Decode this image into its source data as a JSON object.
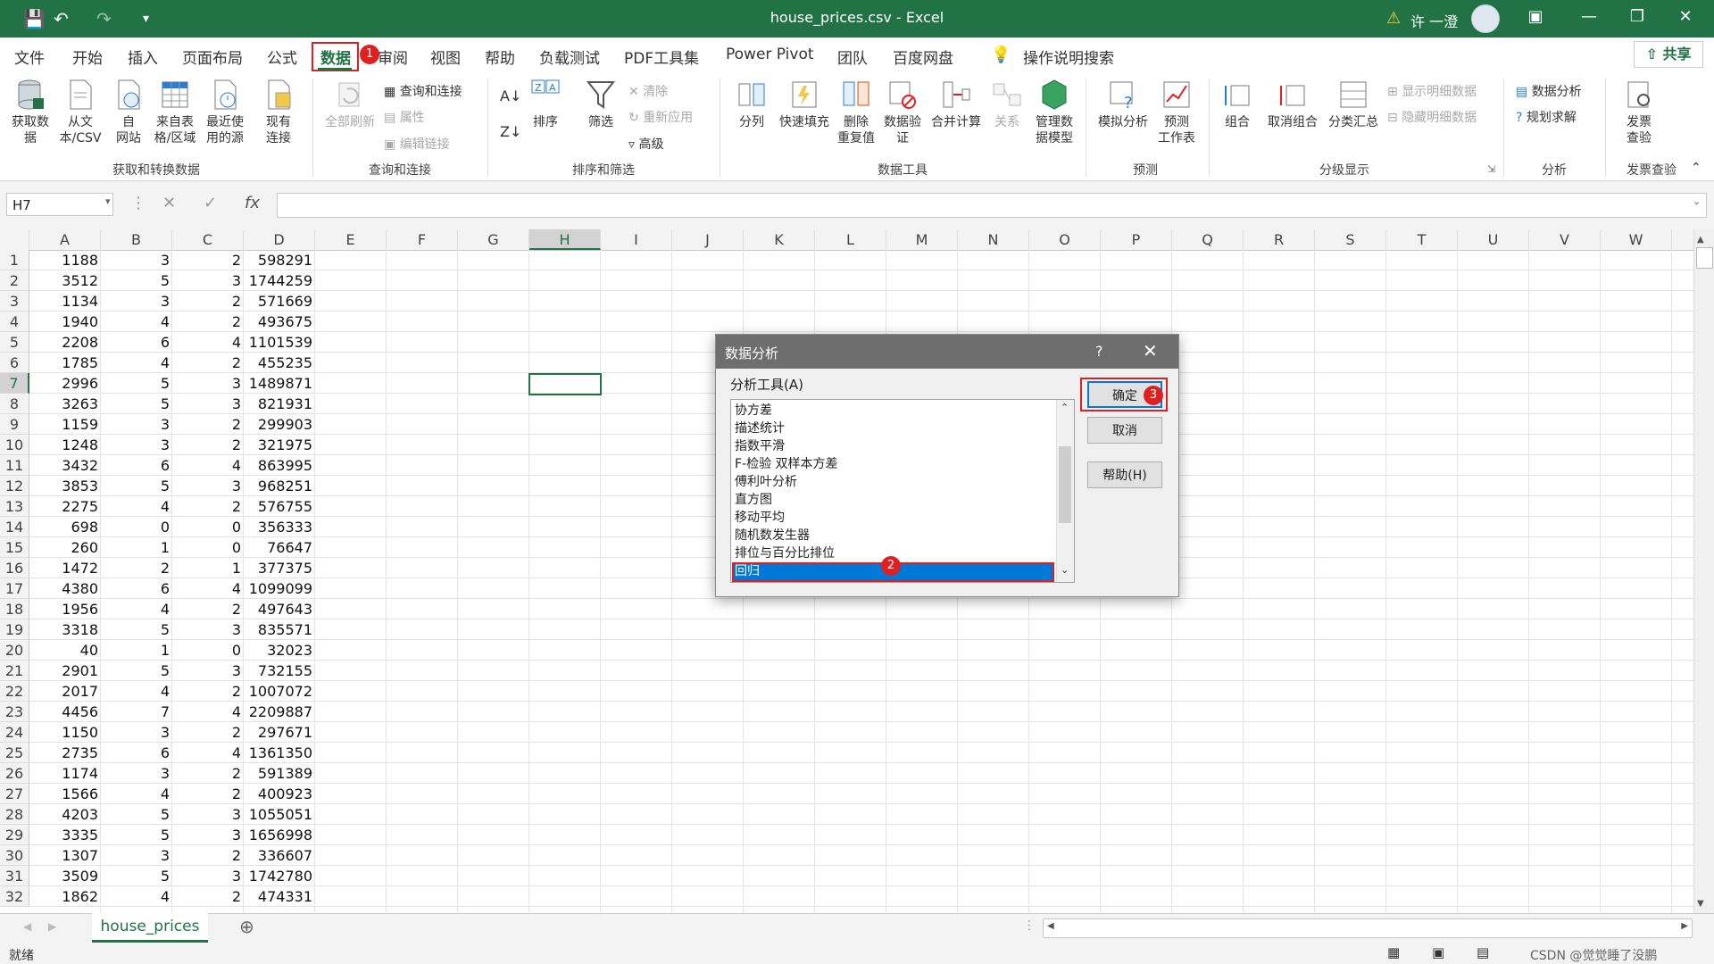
{
  "title": "house_prices.csv  -  Excel",
  "user": "许 一澄",
  "tabs": [
    "文件",
    "开始",
    "插入",
    "页面布局",
    "公式",
    "数据",
    "审阅",
    "视图",
    "帮助",
    "负载测试",
    "PDF工具集",
    "Power Pivot",
    "团队",
    "百度网盘"
  ],
  "tell_me": "操作说明搜索",
  "share": "共享",
  "ribbon": {
    "get_data": "获取数\n据",
    "from_csv": "从文\n本/CSV",
    "from_web": "自\n网站",
    "from_table": "来自表\n格/区域",
    "recent": "最近使\n用的源",
    "existing": "现有\n连接",
    "refresh_all": "全部刷新",
    "queries": "查询和连接",
    "properties": "属性",
    "edit_links": "编辑链接",
    "sort": "排序",
    "filter": "筛选",
    "clear": "清除",
    "reapply": "重新应用",
    "advanced": "高级",
    "text_to_col": "分列",
    "flash_fill": "快速填充",
    "remove_dup": "删除\n重复值",
    "validation": "数据验\n证",
    "consolidate": "合并计算",
    "relations": "关系",
    "data_model": "管理数\n据模型",
    "what_if": "模拟分析",
    "forecast": "预测\n工作表",
    "group": "组合",
    "ungroup": "取消组合",
    "subtotal": "分类汇总",
    "show_detail": "显示明细数据",
    "hide_detail": "隐藏明细数据",
    "data_analysis": "数据分析",
    "solver": "规划求解",
    "invoice": "发票\n查验",
    "groups": [
      "获取和转换数据",
      "查询和连接",
      "排序和筛选",
      "数据工具",
      "预测",
      "分级显示",
      "分析",
      "发票查验"
    ]
  },
  "name_box": "H7",
  "columns": [
    "A",
    "B",
    "C",
    "D",
    "E",
    "F",
    "G",
    "H",
    "I",
    "J",
    "K",
    "L",
    "M",
    "N",
    "O",
    "P",
    "Q",
    "R",
    "S",
    "T",
    "U",
    "V",
    "W"
  ],
  "rows": [
    [
      1188,
      3,
      2,
      598291
    ],
    [
      3512,
      5,
      3,
      1744259
    ],
    [
      1134,
      3,
      2,
      571669
    ],
    [
      1940,
      4,
      2,
      493675
    ],
    [
      2208,
      6,
      4,
      1101539
    ],
    [
      1785,
      4,
      2,
      455235
    ],
    [
      2996,
      5,
      3,
      1489871
    ],
    [
      3263,
      5,
      3,
      821931
    ],
    [
      1159,
      3,
      2,
      299903
    ],
    [
      1248,
      3,
      2,
      321975
    ],
    [
      3432,
      6,
      4,
      863995
    ],
    [
      3853,
      5,
      3,
      968251
    ],
    [
      2275,
      4,
      2,
      576755
    ],
    [
      698,
      0,
      0,
      356333
    ],
    [
      260,
      1,
      0,
      76647
    ],
    [
      1472,
      2,
      1,
      377375
    ],
    [
      4380,
      6,
      4,
      1099099
    ],
    [
      1956,
      4,
      2,
      497643
    ],
    [
      3318,
      5,
      3,
      835571
    ],
    [
      40,
      1,
      0,
      32023
    ],
    [
      2901,
      5,
      3,
      732155
    ],
    [
      2017,
      4,
      2,
      1007072
    ],
    [
      4456,
      7,
      4,
      2209887
    ],
    [
      1150,
      3,
      2,
      297671
    ],
    [
      2735,
      6,
      4,
      1361350
    ],
    [
      1174,
      3,
      2,
      591389
    ],
    [
      1566,
      4,
      2,
      400923
    ],
    [
      4203,
      5,
      3,
      1055051
    ],
    [
      3335,
      5,
      3,
      1656998
    ],
    [
      1307,
      3,
      2,
      336607
    ],
    [
      3509,
      5,
      3,
      1742780
    ],
    [
      1862,
      4,
      2,
      474331
    ]
  ],
  "sheet_tab": "house_prices",
  "status": "就绪",
  "watermark": "CSDN @觉觉睡了没鹏",
  "dialog": {
    "title": "数据分析",
    "help_char": "?",
    "list_label": "分析工具(A)",
    "items": [
      "协方差",
      "描述统计",
      "指数平滑",
      "F-检验 双样本方差",
      "傅利叶分析",
      "直方图",
      "移动平均",
      "随机数发生器",
      "排位与百分比排位",
      "回归"
    ],
    "selected": "回归",
    "ok": "确定",
    "cancel": "取消",
    "help": "帮助(H)"
  },
  "badges": [
    "1",
    "2",
    "3"
  ],
  "colors": {
    "excel_green": "#217346",
    "selection_blue": "#0078d7",
    "annotation_red": "#e02020"
  }
}
